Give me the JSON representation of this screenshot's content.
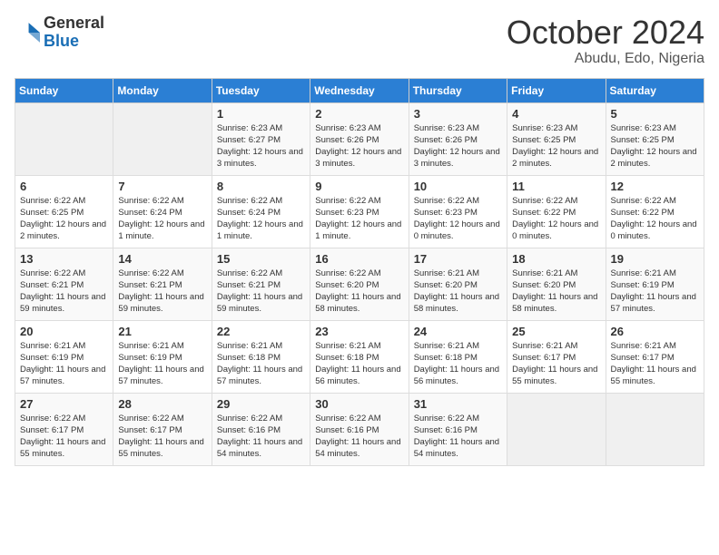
{
  "header": {
    "logo_line1": "General",
    "logo_line2": "Blue",
    "month": "October 2024",
    "location": "Abudu, Edo, Nigeria"
  },
  "weekdays": [
    "Sunday",
    "Monday",
    "Tuesday",
    "Wednesday",
    "Thursday",
    "Friday",
    "Saturday"
  ],
  "weeks": [
    [
      {
        "day": "",
        "info": ""
      },
      {
        "day": "",
        "info": ""
      },
      {
        "day": "1",
        "info": "Sunrise: 6:23 AM\nSunset: 6:27 PM\nDaylight: 12 hours and 3 minutes."
      },
      {
        "day": "2",
        "info": "Sunrise: 6:23 AM\nSunset: 6:26 PM\nDaylight: 12 hours and 3 minutes."
      },
      {
        "day": "3",
        "info": "Sunrise: 6:23 AM\nSunset: 6:26 PM\nDaylight: 12 hours and 3 minutes."
      },
      {
        "day": "4",
        "info": "Sunrise: 6:23 AM\nSunset: 6:25 PM\nDaylight: 12 hours and 2 minutes."
      },
      {
        "day": "5",
        "info": "Sunrise: 6:23 AM\nSunset: 6:25 PM\nDaylight: 12 hours and 2 minutes."
      }
    ],
    [
      {
        "day": "6",
        "info": "Sunrise: 6:22 AM\nSunset: 6:25 PM\nDaylight: 12 hours and 2 minutes."
      },
      {
        "day": "7",
        "info": "Sunrise: 6:22 AM\nSunset: 6:24 PM\nDaylight: 12 hours and 1 minute."
      },
      {
        "day": "8",
        "info": "Sunrise: 6:22 AM\nSunset: 6:24 PM\nDaylight: 12 hours and 1 minute."
      },
      {
        "day": "9",
        "info": "Sunrise: 6:22 AM\nSunset: 6:23 PM\nDaylight: 12 hours and 1 minute."
      },
      {
        "day": "10",
        "info": "Sunrise: 6:22 AM\nSunset: 6:23 PM\nDaylight: 12 hours and 0 minutes."
      },
      {
        "day": "11",
        "info": "Sunrise: 6:22 AM\nSunset: 6:22 PM\nDaylight: 12 hours and 0 minutes."
      },
      {
        "day": "12",
        "info": "Sunrise: 6:22 AM\nSunset: 6:22 PM\nDaylight: 12 hours and 0 minutes."
      }
    ],
    [
      {
        "day": "13",
        "info": "Sunrise: 6:22 AM\nSunset: 6:21 PM\nDaylight: 11 hours and 59 minutes."
      },
      {
        "day": "14",
        "info": "Sunrise: 6:22 AM\nSunset: 6:21 PM\nDaylight: 11 hours and 59 minutes."
      },
      {
        "day": "15",
        "info": "Sunrise: 6:22 AM\nSunset: 6:21 PM\nDaylight: 11 hours and 59 minutes."
      },
      {
        "day": "16",
        "info": "Sunrise: 6:22 AM\nSunset: 6:20 PM\nDaylight: 11 hours and 58 minutes."
      },
      {
        "day": "17",
        "info": "Sunrise: 6:21 AM\nSunset: 6:20 PM\nDaylight: 11 hours and 58 minutes."
      },
      {
        "day": "18",
        "info": "Sunrise: 6:21 AM\nSunset: 6:20 PM\nDaylight: 11 hours and 58 minutes."
      },
      {
        "day": "19",
        "info": "Sunrise: 6:21 AM\nSunset: 6:19 PM\nDaylight: 11 hours and 57 minutes."
      }
    ],
    [
      {
        "day": "20",
        "info": "Sunrise: 6:21 AM\nSunset: 6:19 PM\nDaylight: 11 hours and 57 minutes."
      },
      {
        "day": "21",
        "info": "Sunrise: 6:21 AM\nSunset: 6:19 PM\nDaylight: 11 hours and 57 minutes."
      },
      {
        "day": "22",
        "info": "Sunrise: 6:21 AM\nSunset: 6:18 PM\nDaylight: 11 hours and 57 minutes."
      },
      {
        "day": "23",
        "info": "Sunrise: 6:21 AM\nSunset: 6:18 PM\nDaylight: 11 hours and 56 minutes."
      },
      {
        "day": "24",
        "info": "Sunrise: 6:21 AM\nSunset: 6:18 PM\nDaylight: 11 hours and 56 minutes."
      },
      {
        "day": "25",
        "info": "Sunrise: 6:21 AM\nSunset: 6:17 PM\nDaylight: 11 hours and 55 minutes."
      },
      {
        "day": "26",
        "info": "Sunrise: 6:21 AM\nSunset: 6:17 PM\nDaylight: 11 hours and 55 minutes."
      }
    ],
    [
      {
        "day": "27",
        "info": "Sunrise: 6:22 AM\nSunset: 6:17 PM\nDaylight: 11 hours and 55 minutes."
      },
      {
        "day": "28",
        "info": "Sunrise: 6:22 AM\nSunset: 6:17 PM\nDaylight: 11 hours and 55 minutes."
      },
      {
        "day": "29",
        "info": "Sunrise: 6:22 AM\nSunset: 6:16 PM\nDaylight: 11 hours and 54 minutes."
      },
      {
        "day": "30",
        "info": "Sunrise: 6:22 AM\nSunset: 6:16 PM\nDaylight: 11 hours and 54 minutes."
      },
      {
        "day": "31",
        "info": "Sunrise: 6:22 AM\nSunset: 6:16 PM\nDaylight: 11 hours and 54 minutes."
      },
      {
        "day": "",
        "info": ""
      },
      {
        "day": "",
        "info": ""
      }
    ]
  ]
}
